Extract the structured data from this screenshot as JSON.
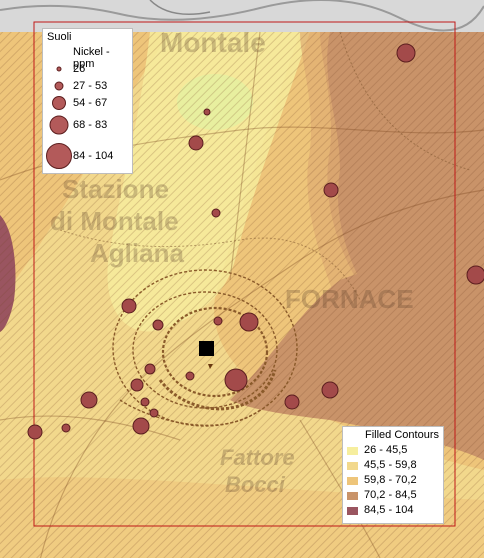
{
  "legend_soil": {
    "title": "Suoli",
    "subtitle": "Nickel - ppm",
    "classes": [
      {
        "label": "26",
        "color": "#b35a5a"
      },
      {
        "label": "27 - 53",
        "color": "#b35a5a"
      },
      {
        "label": "54 - 67",
        "color": "#b35a5a"
      },
      {
        "label": "68 - 83",
        "color": "#b35a5a"
      },
      {
        "label": "84 - 104",
        "color": "#b35a5a"
      }
    ]
  },
  "legend_contours": {
    "title": "Filled Contours",
    "classes": [
      {
        "label": "26 - 45,5",
        "color": "#f6ee9e"
      },
      {
        "label": "45,5 - 59,8",
        "color": "#f2d88c"
      },
      {
        "label": "59,8 - 70,2",
        "color": "#eec57a"
      },
      {
        "label": "70,2 - 84,5",
        "color": "#c99369"
      },
      {
        "label": "84,5 - 104",
        "color": "#9a5560"
      }
    ]
  },
  "basemap_labels": [
    "Montale",
    "Stazione",
    "di Montale",
    "Agliana",
    "FORNACE",
    "Fattore",
    "Bocci"
  ],
  "colors": {
    "frame": "#c01818",
    "sample_fill": "#a34a4a",
    "sample_stroke": "#5b1e1e",
    "source_marker": "#000000",
    "contour_line": "#8a5a2a"
  }
}
